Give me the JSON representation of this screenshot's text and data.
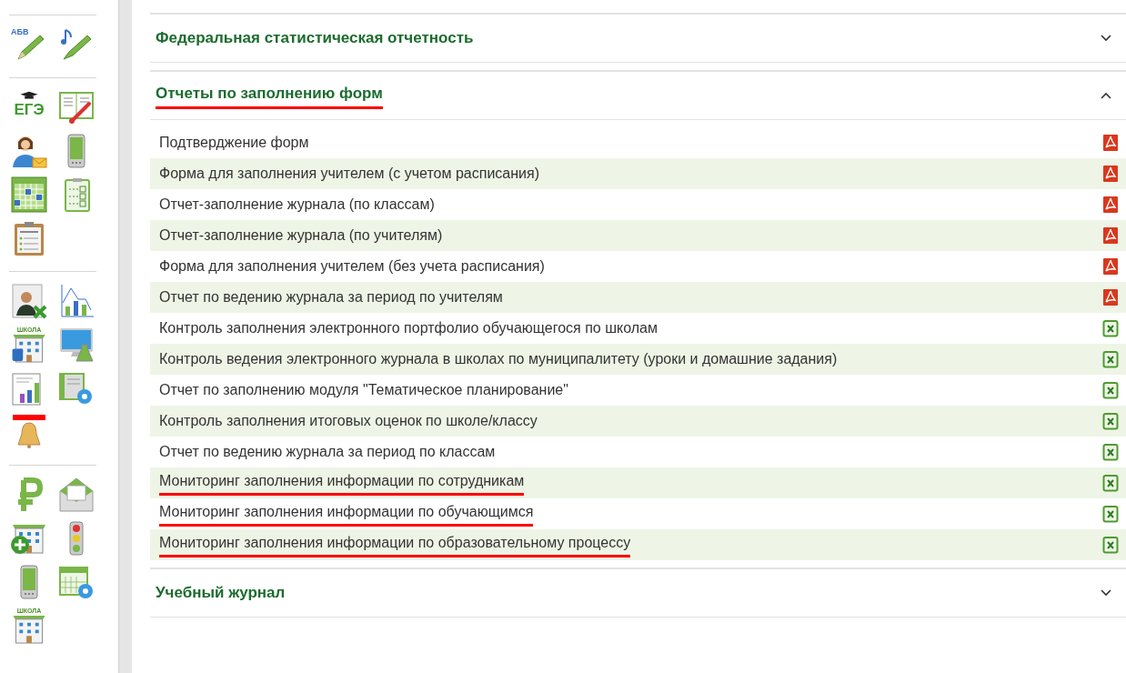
{
  "sidebar": {
    "groups": [
      {
        "icons": [
          {
            "kind": "letters-pencil",
            "label": "АБВ"
          },
          {
            "kind": "note-pencil"
          }
        ]
      },
      {
        "icons": [
          {
            "kind": "exam",
            "label": "ЕГЭ"
          },
          {
            "kind": "book-thermometer"
          },
          {
            "kind": "teacher-mail"
          },
          {
            "kind": "phone"
          },
          {
            "kind": "calendar"
          },
          {
            "kind": "checklist"
          },
          {
            "kind": "clipboard"
          }
        ]
      },
      {
        "icons": [
          {
            "kind": "person-sheet"
          },
          {
            "kind": "chart"
          },
          {
            "kind": "school-info",
            "label": "ШКОЛА"
          },
          {
            "kind": "monitor-flask"
          },
          {
            "kind": "report-chart"
          },
          {
            "kind": "book-gear"
          },
          {
            "kind": "bell"
          }
        ]
      },
      {
        "icons": [
          {
            "kind": "ruble"
          },
          {
            "kind": "envelope"
          },
          {
            "kind": "school-plus"
          },
          {
            "kind": "traffic-light"
          },
          {
            "kind": "phone"
          },
          {
            "kind": "calendar-gear"
          },
          {
            "kind": "school",
            "label": "ШКОЛА"
          }
        ]
      }
    ]
  },
  "sections": [
    {
      "title": "Федеральная статистическая отчетность",
      "expanded": false,
      "underlined": false
    },
    {
      "title": "Отчеты по заполнению форм",
      "expanded": true,
      "underlined": true,
      "items": [
        {
          "label": "Подтверджение форм",
          "kind": "pdf",
          "underlined": false
        },
        {
          "label": "Форма для заполнения учителем (с учетом расписания)",
          "kind": "pdf",
          "underlined": false
        },
        {
          "label": "Отчет-заполнение журнала (по классам)",
          "kind": "pdf",
          "underlined": false
        },
        {
          "label": "Отчет-заполнение журнала (по учителям)",
          "kind": "pdf",
          "underlined": false
        },
        {
          "label": "Форма для заполнения учителем (без учета расписания)",
          "kind": "pdf",
          "underlined": false
        },
        {
          "label": "Отчет по ведению журнала за период по учителям",
          "kind": "pdf",
          "underlined": false
        },
        {
          "label": "Контроль заполнения электронного портфолио обучающегося по школам",
          "kind": "xls",
          "underlined": false
        },
        {
          "label": "Контроль ведения электронного журнала в школах по муниципалитету (уроки и домашние задания)",
          "kind": "xls",
          "underlined": false
        },
        {
          "label": "Отчет по заполнению модуля \"Тематическое планирование\"",
          "kind": "xls",
          "underlined": false
        },
        {
          "label": "Контроль заполнения итоговых оценок по школе/классу",
          "kind": "xls",
          "underlined": false
        },
        {
          "label": "Отчет по ведению журнала за период по классам",
          "kind": "xls",
          "underlined": false
        },
        {
          "label": "Мониторинг заполнения информации по сотрудникам",
          "kind": "xls",
          "underlined": true
        },
        {
          "label": "Мониторинг заполнения информации по обучающимся",
          "kind": "xls",
          "underlined": true
        },
        {
          "label": "Мониторинг заполнения информации по образовательному процессу",
          "kind": "xls",
          "underlined": true
        }
      ]
    },
    {
      "title": "Учебный журнал",
      "expanded": false,
      "underlined": false
    }
  ]
}
